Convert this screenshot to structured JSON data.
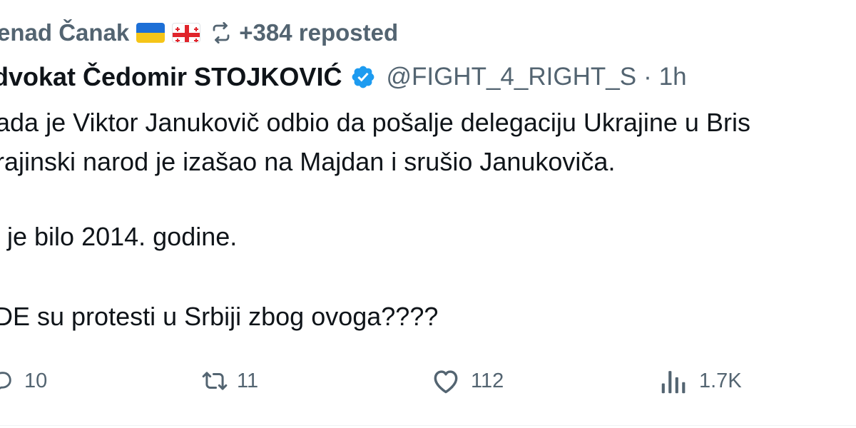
{
  "repost": {
    "user": "enad Čanak",
    "flag_icons": [
      "ukraine-flag",
      "georgia-flag"
    ],
    "text": "+384 reposted"
  },
  "author": {
    "name": "dvokat Čedomir STOJKOVIĆ",
    "verified": true,
    "verified_color": "#1d9bf0",
    "handle": "@FIGHT_4_RIGHT_S",
    "separator": "·",
    "time": "1h"
  },
  "body": {
    "lines": [
      "ada je Viktor Janukovič odbio da pošalje delegaciju Ukrajine u Bris",
      "rajinski narod je izašao na Majdan i srušio Janukoviča.",
      "je bilo 2014. godine.",
      "DE su protesti u Srbiji zbog ovoga????"
    ]
  },
  "actions": {
    "reply": {
      "icon": "reply-icon",
      "count": "10"
    },
    "repost": {
      "icon": "repost-icon",
      "count": "11"
    },
    "like": {
      "icon": "heart-icon",
      "count": "112"
    },
    "views": {
      "icon": "analytics-icon",
      "count": "1.7K"
    }
  },
  "colors": {
    "text_primary": "#0f1419",
    "text_secondary": "#536471",
    "verified": "#1d9bf0"
  }
}
